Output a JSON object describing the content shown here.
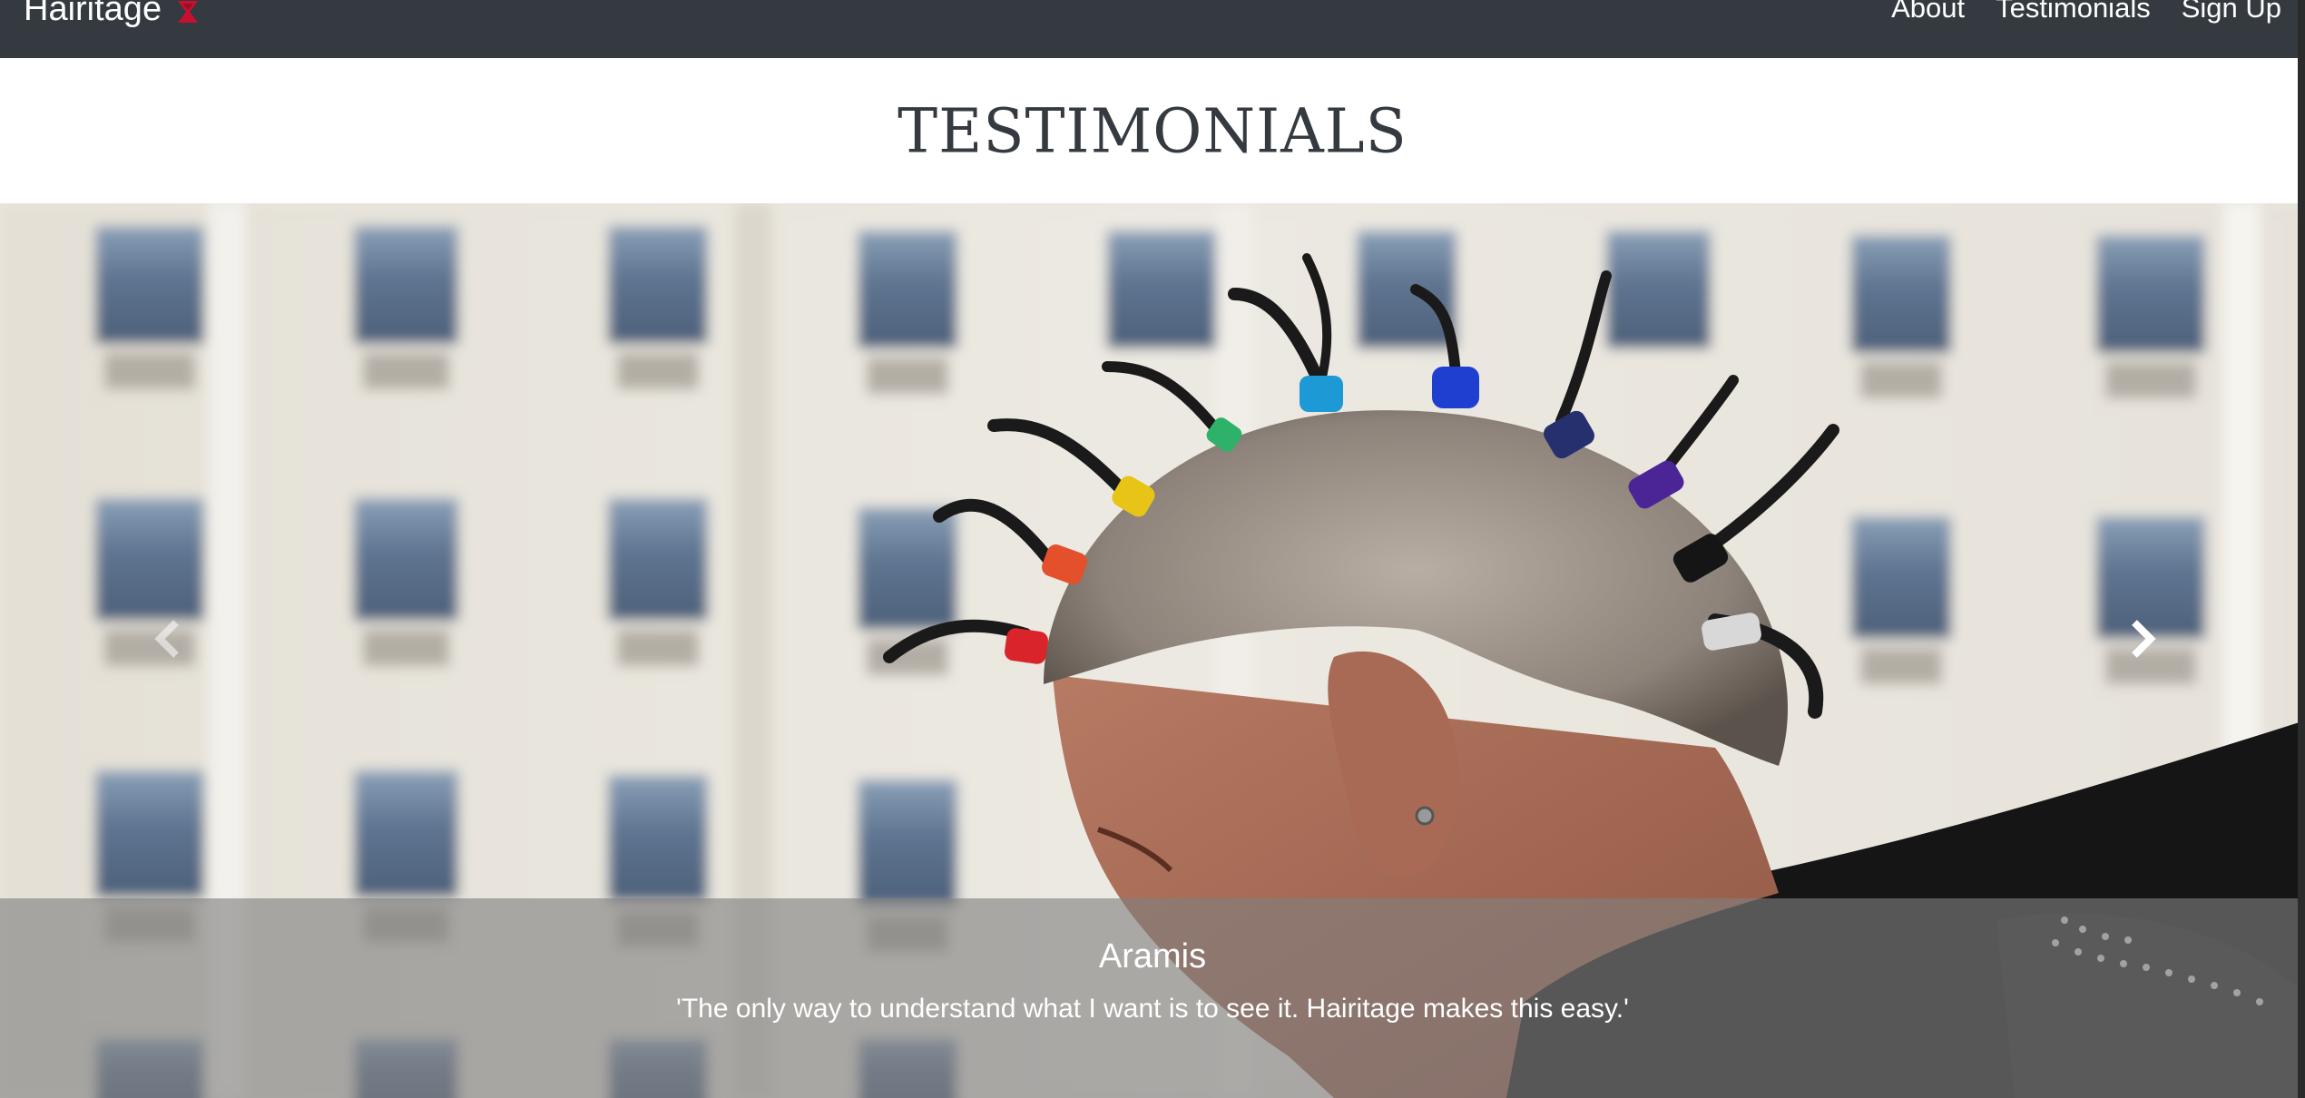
{
  "navbar": {
    "brand": "Hairitage",
    "links": [
      "About",
      "Testimonials",
      "Sign Up"
    ]
  },
  "heading": {
    "title": "TESTIMONIALS"
  },
  "carousel": {
    "slide": {
      "name": "Aramis",
      "quote": "'The only way to understand what I want is to see it. Hairitage makes this easy.'"
    },
    "controls": {
      "prev_icon": "chevron-left-icon",
      "next_icon": "chevron-right-icon"
    }
  },
  "colors": {
    "navbar_bg": "#343a40",
    "caption_bg": "rgba(128,128,128,0.62)",
    "logo_red": "#c8102e"
  }
}
